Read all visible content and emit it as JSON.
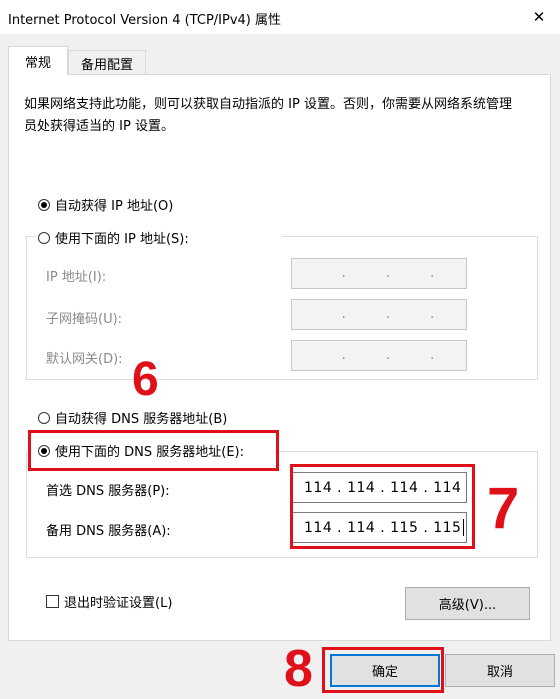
{
  "window": {
    "title": "Internet Protocol Version 4 (TCP/IPv4) 属性",
    "close_symbol": "✕"
  },
  "tabs": [
    {
      "label": "常规",
      "active": true
    },
    {
      "label": "备用配置",
      "active": false
    }
  ],
  "description": "如果网络支持此功能，则可以获取自动指派的 IP 设置。否则，你需要从网络系统管理员处获得适当的 IP 设置。",
  "ip_settings": {
    "auto_label": "自动获得 IP 地址(O)",
    "manual_label": "使用下面的 IP 地址(S):",
    "fields": [
      {
        "label": "IP 地址(I):",
        "value": ". . ."
      },
      {
        "label": "子网掩码(U):",
        "value": ". . ."
      },
      {
        "label": "默认网关(D):",
        "value": ". . ."
      }
    ]
  },
  "dns_settings": {
    "auto_label": "自动获得 DNS 服务器地址(B)",
    "manual_label": "使用下面的 DNS 服务器地址(E):",
    "preferred_label": "首选 DNS 服务器(P):",
    "preferred_value": "114 . 114 . 114 . 114",
    "alternate_label": "备用 DNS 服务器(A):",
    "alternate_value": "114 . 114 . 115 . 115"
  },
  "validate_label": "退出时验证设置(L)",
  "advanced_button": "高级(V)...",
  "ok_button": "确定",
  "cancel_button": "取消",
  "annotations": {
    "step6": "6",
    "step7": "7",
    "step8": "8",
    "color": "#e0101a"
  }
}
